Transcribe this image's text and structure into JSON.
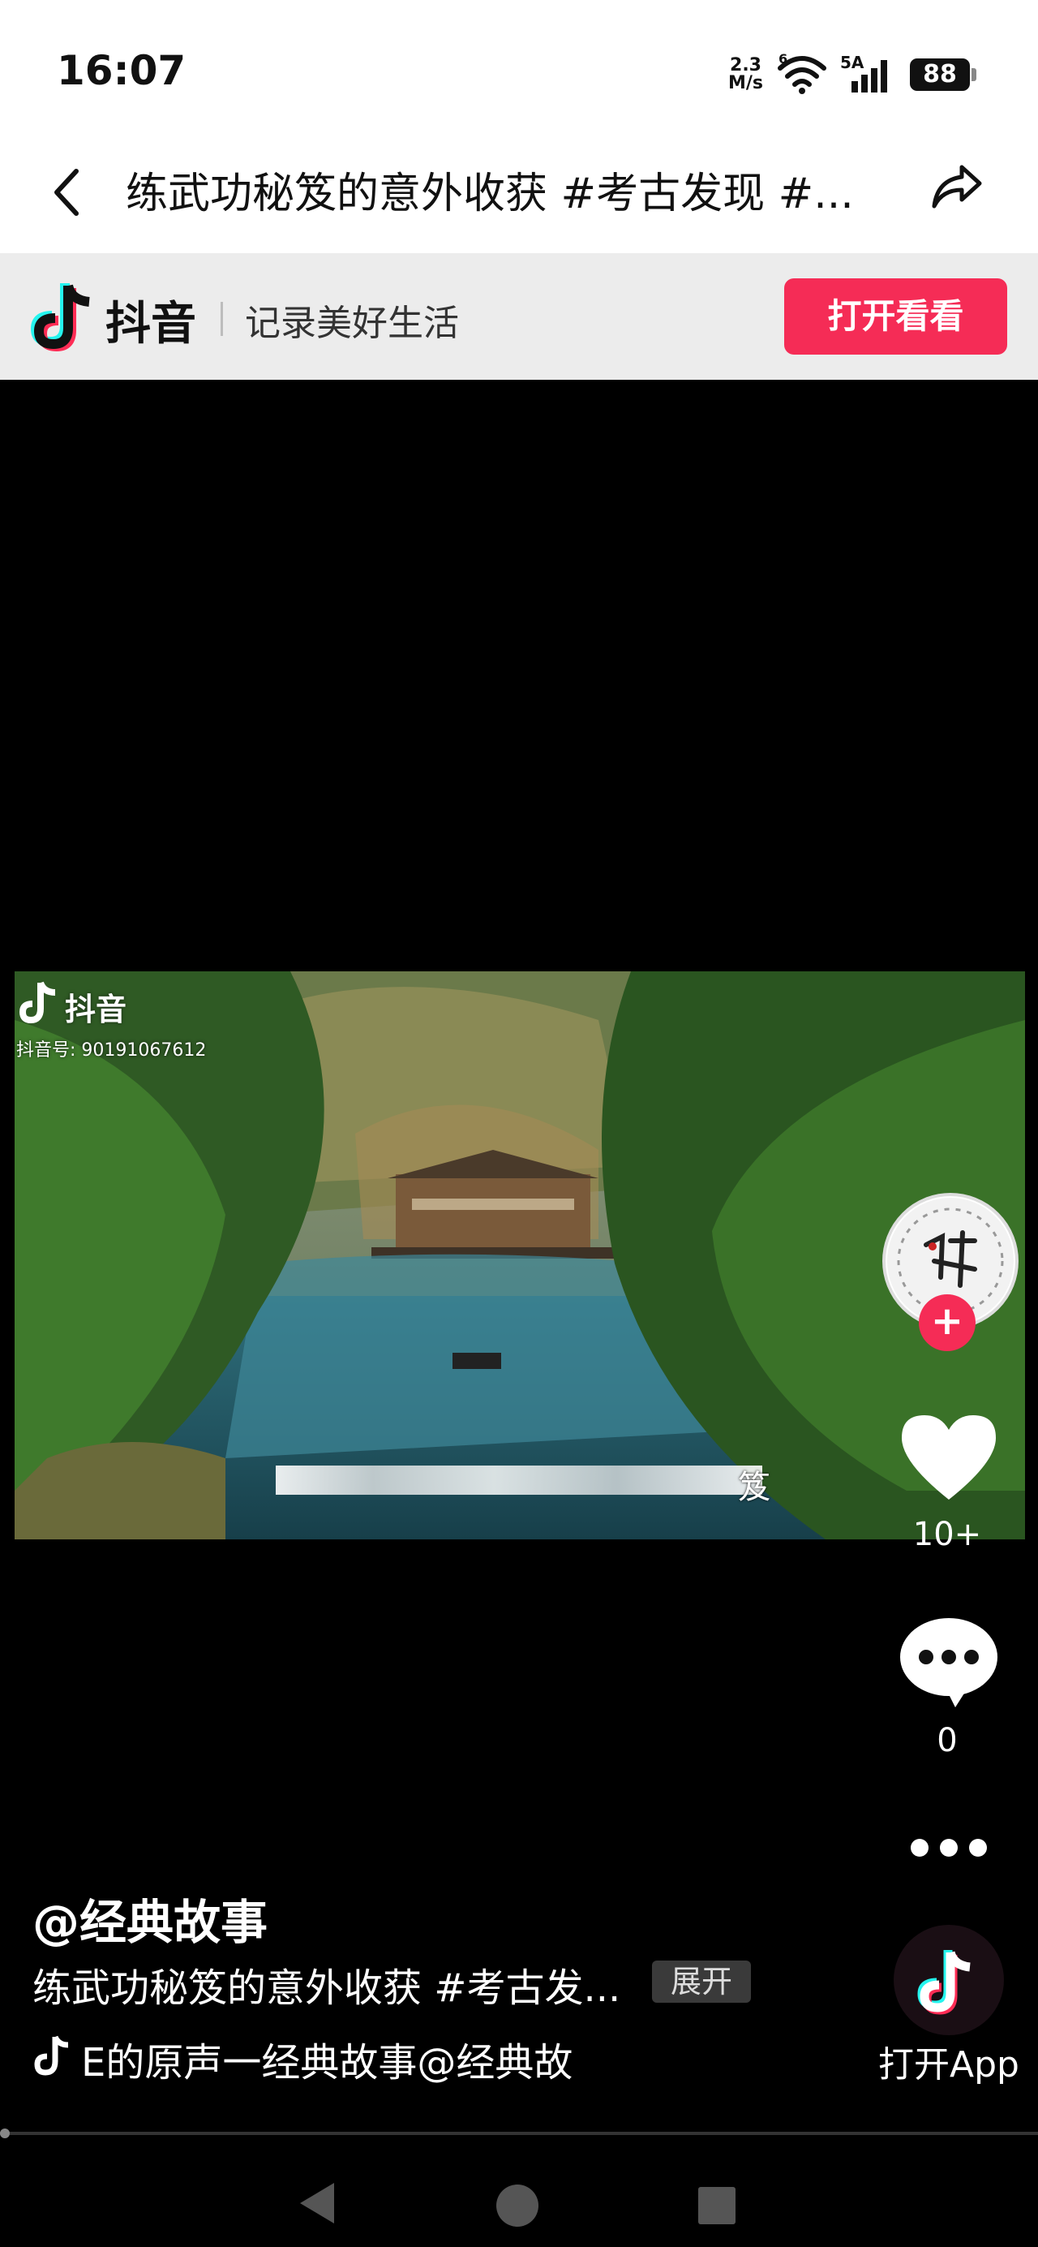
{
  "status_bar": {
    "time": "16:07",
    "net_speed_value": "2.3",
    "net_speed_unit": "M/s",
    "wifi_label": "6",
    "cell_label": "5A",
    "battery": "88"
  },
  "header": {
    "title": "练武功秘笈的意外收获 #考古发现 #..."
  },
  "banner": {
    "brand": "抖音",
    "slogan": "记录美好生活",
    "open_button": "打开看看"
  },
  "video": {
    "watermark_brand": "抖音",
    "watermark_id": "抖音号: 90191067612",
    "subtitle_end": "笈"
  },
  "actions": {
    "like_count": "10+",
    "comment_count": "0",
    "open_app": "打开App"
  },
  "info": {
    "author": "@经典故事",
    "description": "练武功秘笈的意外收获 #考古发...",
    "expand": "展开",
    "music": "E的原声一经典故事@经典故"
  },
  "colors": {
    "accent": "#f52c56",
    "background": "#000000",
    "banner_bg": "#ececec"
  }
}
